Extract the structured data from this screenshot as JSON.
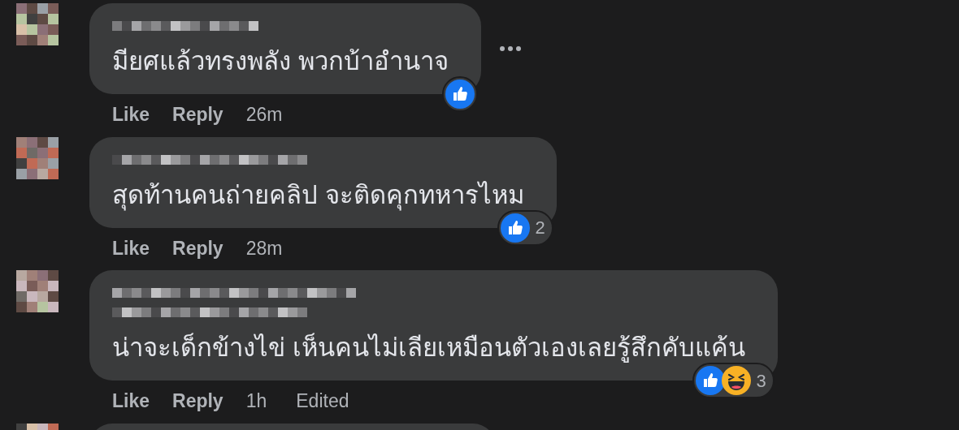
{
  "comments": [
    {
      "text": "มียศแล้วทรงพลัง พวกบ้าอำนาจ",
      "actions": [
        "Like",
        "Reply"
      ],
      "time": "26m",
      "menu_visible": true,
      "reactions": [
        {
          "kind": "like"
        }
      ]
    },
    {
      "text": "สุดท้านคนถ่ายคลิป จะติดคุกทหารไหม",
      "actions": [
        "Like",
        "Reply"
      ],
      "time": "28m",
      "menu_visible": false,
      "reactions": [
        {
          "kind": "like"
        }
      ],
      "reaction_count": "2"
    },
    {
      "text": "น่าจะเด็กข้างไข่ เห็นคนไม่เลียเหมือนตัวเองเลยรู้สึกคับแค้น",
      "actions": [
        "Like",
        "Reply"
      ],
      "time": "1h",
      "edited_label": "Edited",
      "menu_visible": false,
      "reactions": [
        {
          "kind": "like"
        },
        {
          "kind": "haha"
        }
      ],
      "reaction_count": "3"
    }
  ]
}
